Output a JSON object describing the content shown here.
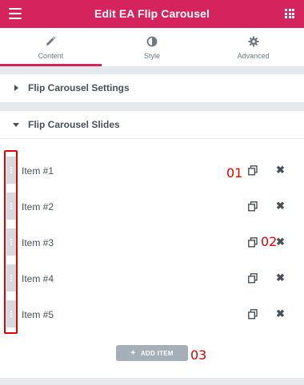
{
  "header": {
    "title": "Edit EA Flip Carousel",
    "menu_icon": "hamburger-menu-icon",
    "grid_icon": "apps-grid-icon",
    "color": "#d5245d"
  },
  "tabs": [
    {
      "label": "Content",
      "icon": "pencil-icon",
      "active": true
    },
    {
      "label": "Style",
      "icon": "half-circle-icon",
      "active": false
    },
    {
      "label": "Advanced",
      "icon": "gear-icon",
      "active": false
    }
  ],
  "sections": {
    "settings": {
      "title": "Flip Carousel Settings",
      "expanded": false
    },
    "slides": {
      "title": "Flip Carousel Slides",
      "expanded": true
    }
  },
  "items": [
    {
      "label": "Item #1"
    },
    {
      "label": "Item #2"
    },
    {
      "label": "Item #3"
    },
    {
      "label": "Item #4"
    },
    {
      "label": "Item #5"
    }
  ],
  "add_button": {
    "label": "ADD ITEM",
    "icon": "plus-icon"
  },
  "annotations": {
    "m1": "01",
    "m2": "02",
    "m3": "03"
  }
}
